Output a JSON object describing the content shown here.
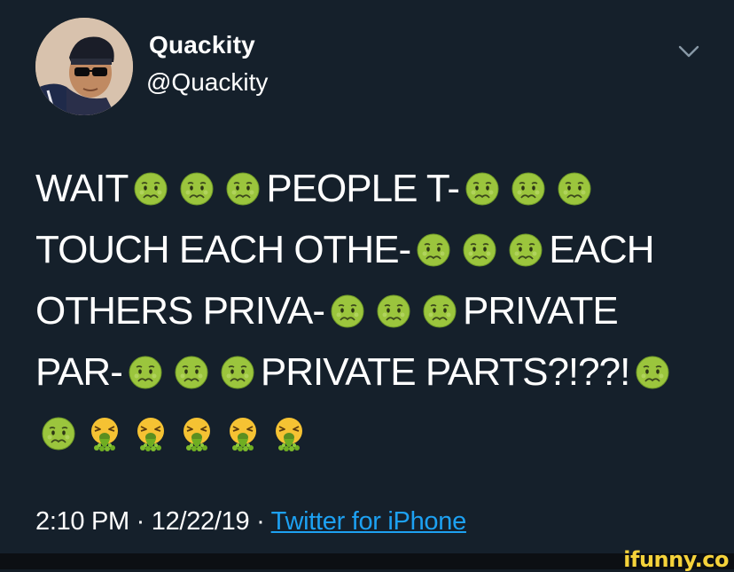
{
  "author": {
    "display_name": "Quackity",
    "handle": "@Quackity",
    "avatar_icon": "profile-photo"
  },
  "tweet": {
    "lines": [
      [
        {
          "t": "text",
          "v": "WAIT"
        },
        {
          "t": "emoji",
          "v": "nauseated-face"
        },
        {
          "t": "emoji",
          "v": "nauseated-face"
        },
        {
          "t": "emoji",
          "v": "nauseated-face"
        },
        {
          "t": "text",
          "v": "PEOPLE T-"
        },
        {
          "t": "emoji",
          "v": "nauseated-face"
        },
        {
          "t": "emoji",
          "v": "nauseated-face"
        },
        {
          "t": "emoji",
          "v": "nauseated-face"
        }
      ],
      [
        {
          "t": "text",
          "v": "TOUCH EACH OTHE-"
        },
        {
          "t": "emoji",
          "v": "nauseated-face"
        },
        {
          "t": "emoji",
          "v": "nauseated-face"
        },
        {
          "t": "emoji",
          "v": "nauseated-face"
        },
        {
          "t": "text",
          "v": "EACH"
        }
      ],
      [
        {
          "t": "text",
          "v": "OTHERS PRIVA-"
        },
        {
          "t": "emoji",
          "v": "nauseated-face"
        },
        {
          "t": "emoji",
          "v": "nauseated-face"
        },
        {
          "t": "emoji",
          "v": "nauseated-face"
        },
        {
          "t": "text",
          "v": "PRIVATE"
        }
      ],
      [
        {
          "t": "text",
          "v": "PAR-"
        },
        {
          "t": "emoji",
          "v": "nauseated-face"
        },
        {
          "t": "emoji",
          "v": "nauseated-face"
        },
        {
          "t": "emoji",
          "v": "nauseated-face"
        },
        {
          "t": "text",
          "v": "PRIVATE PARTS?!??!"
        },
        {
          "t": "emoji",
          "v": "nauseated-face"
        }
      ],
      [
        {
          "t": "emoji",
          "v": "nauseated-face"
        },
        {
          "t": "emoji",
          "v": "vomiting-face"
        },
        {
          "t": "emoji",
          "v": "vomiting-face"
        },
        {
          "t": "emoji",
          "v": "vomiting-face"
        },
        {
          "t": "emoji",
          "v": "vomiting-face"
        },
        {
          "t": "emoji",
          "v": "vomiting-face"
        }
      ]
    ],
    "time": "2:10 PM",
    "separator": "·",
    "date": "12/22/19",
    "source": "Twitter for iPhone"
  },
  "menu_icon": "chevron-down-icon",
  "watermark": "ifunny.co",
  "colors": {
    "background": "#15202b",
    "text": "#ffffff",
    "link": "#1da1f2",
    "watermark": "#f5d23a"
  }
}
